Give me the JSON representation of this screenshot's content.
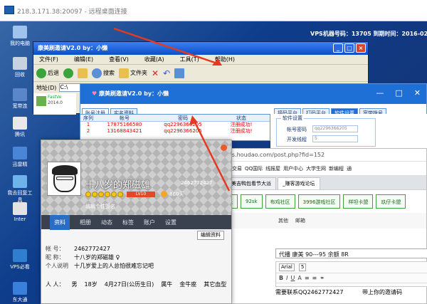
{
  "rdp": {
    "title": "218.3.171.38:20097 - 远程桌面连接"
  },
  "vps": {
    "info": "VPS机器号码：13705   到期时间：2016-02-03"
  },
  "desktop_icons": [
    {
      "label": "我的电脑",
      "color": "#9fc3ec"
    },
    {
      "label": "回收",
      "color": "#c8d3e0"
    },
    {
      "label": "宽带连",
      "color": "#5b86c9"
    },
    {
      "label": "腾讯",
      "color": "#e9e9e9"
    },
    {
      "label": "迅雷精",
      "color": "#4a86d8"
    },
    {
      "label": "我去回复工具",
      "color": "#6eb3ea"
    },
    {
      "label": "Inter",
      "color": "#e3e3e3"
    },
    {
      "label": "VPS必看",
      "color": "#2f7fd0"
    },
    {
      "label": "东大通",
      "color": "#3a7fd9"
    }
  ],
  "explorer": {
    "title": "康美刷邀请V2.0       by：小懒",
    "menus": [
      "文件(F)",
      "编辑(E)",
      "查看(V)",
      "收藏(A)",
      "工具(T)",
      "帮助(H)"
    ],
    "back": "后退",
    "search": "搜索",
    "folder": "文件夹",
    "address_label": "地址(D)",
    "address_value": "C:\\",
    "file_name": "FastVe",
    "file_date": "2014.0"
  },
  "app": {
    "title": "康美刷邀请V2.0       by：小懒",
    "tabs_left": [
      "账号注册",
      "实名资料"
    ],
    "tabs_right": [
      "接码平台",
      "打码平台",
      "软件设置",
      "宽带拨号"
    ],
    "table_headers": [
      "序列",
      "帐号",
      "密码",
      "状态"
    ],
    "rows": [
      [
        "1",
        "17875166580",
        "qq2296366205",
        "注册成功!"
      ],
      [
        "2",
        "13168843421",
        "qq2296366205",
        "注册成功!"
      ]
    ],
    "settings": {
      "group": "软件设置",
      "account_label": "帐号密码",
      "account_value": "qq2296366205",
      "threads_label": "开发线程",
      "threads_value": "5"
    }
  },
  "browser": {
    "url": "os.houdao.com/post.php?fid=152",
    "bookmarks": [
      "QQ交易",
      "QQ国际",
      "线报屋",
      "用户中心",
      "大学生网",
      "新编程",
      "通"
    ],
    "tabs": [
      "康美吉鸭包看节大派",
      "_赚客游戏论坛"
    ],
    "nav_items": [
      "坛",
      "92sk",
      "布鸡社区",
      "3996游戏社区",
      "样坦卡盟",
      "玖仔卡盟"
    ],
    "subnav": [
      "其他",
      "邮箱"
    ],
    "post_title": "代播 康美 90---95  余额     8R",
    "font": "Arial",
    "size": "5",
    "body_left": "需要联系QQ2462772427",
    "body_right": "带上你的邀请码"
  },
  "qq": {
    "name": "十八岁的郑磁雄",
    "qq_number": "2462772427",
    "level_label": "LV10",
    "score": "860天",
    "signature": "编辑个性签名",
    "nav": [
      "资料",
      "相册",
      "动态",
      "标签",
      "账户",
      "设置"
    ],
    "edit_btn": "编辑资料",
    "fields": [
      {
        "k": "帐    号：",
        "v": "2462772427"
      },
      {
        "k": "昵    称：",
        "v": "十八岁的郑磁雄 ♀"
      },
      {
        "k": "个人说明",
        "v": "十几岁爱上的人总怕很难忘记吧"
      }
    ],
    "person": {
      "k": "人    人：",
      "sex": "男",
      "age": "18岁",
      "birthday": "4月27日(公历生日)",
      "zodiac": "属牛",
      "star": "金牛座",
      "blood": "其它血型"
    }
  }
}
